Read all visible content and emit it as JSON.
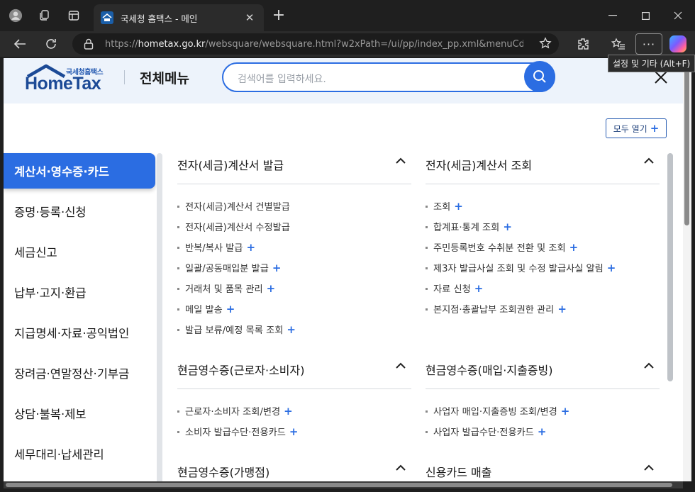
{
  "browser": {
    "tab_title": "국세청 홈택스 - 메인",
    "url_scheme": "https://",
    "url_domain": "hometax.go.kr",
    "url_path": "/websquare/websquare.html?w2xPath=/ui/pp/index_pp.xml&menuCd=i...",
    "tooltip": "설정 및 기타 (Alt+F)",
    "more_label": "···"
  },
  "header": {
    "logo_small": "국세청홈택스",
    "logo_main": "HomeTax",
    "title": "전체메뉴",
    "search_placeholder": "검색어를 입력하세요."
  },
  "open_all": {
    "label": "모두 열기",
    "plus": "+"
  },
  "sidebar": {
    "items": [
      {
        "label": "계산서·영수증·카드",
        "active": true
      },
      {
        "label": "증명·등록·신청"
      },
      {
        "label": "세금신고"
      },
      {
        "label": "납부·고지·환급"
      },
      {
        "label": "지급명세·자료·공익법인"
      },
      {
        "label": "장려금·연말정산·기부금"
      },
      {
        "label": "상담·불복·제보"
      },
      {
        "label": "세무대리·납세관리"
      }
    ]
  },
  "sections": {
    "s1": {
      "title": "전자(세금)계산서 발급",
      "links": [
        {
          "label": "전자(세금)계산서 건별발급",
          "plus": ""
        },
        {
          "label": "전자(세금)계산서 수정발급",
          "plus": ""
        },
        {
          "label": "반복/복사 발급",
          "plus": "+"
        },
        {
          "label": "일괄/공동매입분 발급",
          "plus": "+"
        },
        {
          "label": "거래처 및 품목 관리",
          "plus": "+"
        },
        {
          "label": "메일 발송",
          "plus": "+"
        },
        {
          "label": "발급 보류/예정 목록 조회",
          "plus": "+"
        }
      ]
    },
    "s2": {
      "title": "전자(세금)계산서 조회",
      "links": [
        {
          "label": "조회",
          "plus": "+"
        },
        {
          "label": "합계표·통계 조회",
          "plus": "+"
        },
        {
          "label": "주민등록번호 수취분 전환 및 조회",
          "plus": "+"
        },
        {
          "label": "제3자 발급사실 조회 및 수정 발급사실 알림",
          "plus": "+"
        },
        {
          "label": "자료 신청",
          "plus": "+"
        },
        {
          "label": "본지점·총괄납부 조회권한 관리",
          "plus": "+"
        }
      ]
    },
    "s3": {
      "title": "현금영수증(근로자·소비자)",
      "links": [
        {
          "label": "근로자·소비자 조회/변경",
          "plus": "+"
        },
        {
          "label": "소비자 발급수단·전용카드",
          "plus": "+"
        }
      ]
    },
    "s4": {
      "title": "현금영수증(매입·지출증빙)",
      "links": [
        {
          "label": "사업자 매입·지출증빙 조회/변경",
          "plus": "+"
        },
        {
          "label": "사업자 발급수단·전용카드",
          "plus": "+"
        }
      ]
    },
    "s5": {
      "title": "현금영수증(가맹점)"
    },
    "s6": {
      "title": "신용카드 매출"
    }
  }
}
